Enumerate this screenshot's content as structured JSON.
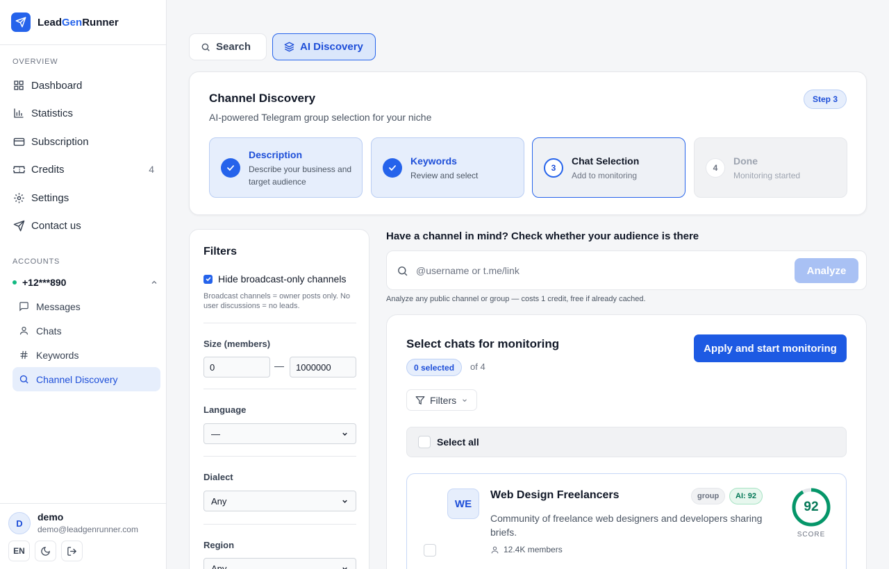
{
  "brand": {
    "part1": "Lead",
    "part2": "Gen",
    "part3": "Runner"
  },
  "sidebar": {
    "overview_label": "OVERVIEW",
    "nav": [
      {
        "label": "Dashboard",
        "icon": "grid-icon"
      },
      {
        "label": "Statistics",
        "icon": "bar-chart-icon"
      },
      {
        "label": "Subscription",
        "icon": "card-icon"
      },
      {
        "label": "Credits",
        "icon": "ticket-icon",
        "count": "4"
      },
      {
        "label": "Settings",
        "icon": "gear-icon"
      },
      {
        "label": "Contact us",
        "icon": "send-icon"
      }
    ],
    "accounts_label": "ACCOUNTS",
    "account": {
      "phone": "+12***890",
      "status_color": "#10b981"
    },
    "sub_items": [
      {
        "label": "Messages",
        "icon": "message-icon"
      },
      {
        "label": "Chats",
        "icon": "user-icon"
      },
      {
        "label": "Keywords",
        "icon": "hash-icon"
      },
      {
        "label": "Channel Discovery",
        "icon": "search-icon",
        "active": true
      }
    ]
  },
  "user": {
    "initial": "D",
    "name": "demo",
    "email": "demo@leadgenrunner.com",
    "lang": "EN"
  },
  "tabs": {
    "search": "Search",
    "ai": "AI Discovery"
  },
  "discovery": {
    "title": "Channel Discovery",
    "subtitle": "AI-powered Telegram group selection for your niche",
    "step_badge": "Step 3",
    "steps": [
      {
        "num": "",
        "title": "Description",
        "desc": "Describe your business and target audience",
        "state": "done"
      },
      {
        "num": "",
        "title": "Keywords",
        "desc": "Review and select",
        "state": "done"
      },
      {
        "num": "3",
        "title": "Chat Selection",
        "desc": "Add to monitoring",
        "state": "current"
      },
      {
        "num": "4",
        "title": "Done",
        "desc": "Monitoring started",
        "state": "todo"
      }
    ]
  },
  "filters": {
    "title": "Filters",
    "hide_broadcast": "Hide broadcast-only channels",
    "hide_broadcast_checked": true,
    "note": "Broadcast channels = owner posts only. No user discussions = no leads.",
    "size_label": "Size (members)",
    "size_min": "0",
    "size_sep": "—",
    "size_max": "1000000",
    "language_label": "Language",
    "language_value": "—",
    "dialect_label": "Dialect",
    "dialect_value": "Any",
    "region_label": "Region",
    "region_value": "Any"
  },
  "analyze": {
    "title": "Have a channel in mind? Check whether your audience is there",
    "placeholder": "@username or t.me/link",
    "button": "Analyze",
    "note": "Analyze any public channel or group — costs 1 credit, free if already cached."
  },
  "selection": {
    "title": "Select chats for monitoring",
    "selected": "0 selected",
    "of": "of 4",
    "apply": "Apply and start monitoring",
    "filters_btn": "Filters",
    "select_all": "Select all"
  },
  "chat": {
    "initials": "WE",
    "name": "Web Design Freelancers",
    "type_tag": "group",
    "ai_tag": "AI: 92",
    "description": "Community of freelance web designers and developers sharing briefs.",
    "members": "12.4K members",
    "score": "92",
    "score_value": 92,
    "score_label": "SCORE"
  },
  "colors": {
    "accent": "#2563eb",
    "success": "#047857"
  }
}
